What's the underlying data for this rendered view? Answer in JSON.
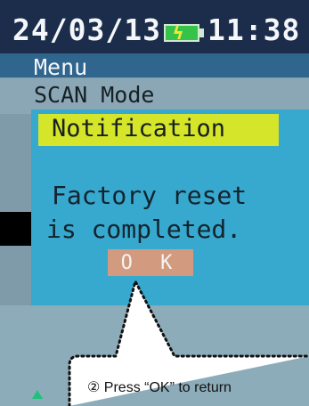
{
  "status": {
    "date": "24/03/13",
    "time": "11:38"
  },
  "menu": {
    "title": "Menu",
    "item": "SCAN Mode"
  },
  "dialog": {
    "title": "Notification",
    "message_line1": "Factory reset",
    "message_line2": "is completed.",
    "ok_label": "O K"
  },
  "callout": {
    "text": "② Press “OK” to return"
  },
  "icons": {
    "battery": "battery-charging-icon",
    "nav": "up-arrow-icon"
  },
  "colors": {
    "status_bar": "#1b2d4a",
    "menu_bar": "#30658e",
    "dialog_bg": "#37a8ce",
    "notification_bar": "#d4e52a",
    "ok_button": "#d29b80",
    "battery": "#37c24a"
  }
}
